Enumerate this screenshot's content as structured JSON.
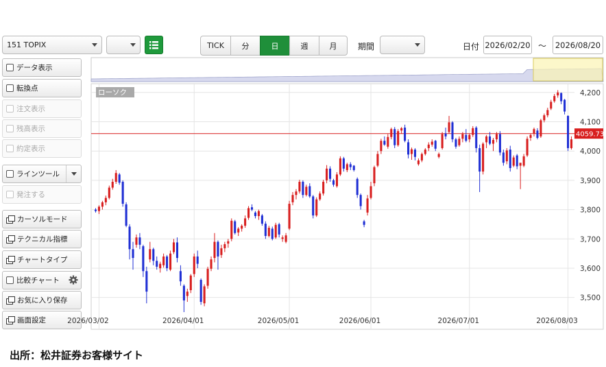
{
  "toolbar": {
    "symbol_select": "151 TOPIX",
    "secondary_select": "",
    "intervals": [
      "TICK",
      "分",
      "日",
      "週",
      "月"
    ],
    "active_interval": "日",
    "period_label": "期間",
    "period_select": "",
    "date_label": "日付",
    "date_from": "2026/02/20",
    "date_sep": "〜",
    "date_to": "2026/08/20"
  },
  "sidebar": {
    "items": [
      {
        "label": "データ表示",
        "kind": "checkbox",
        "enabled": true
      },
      {
        "label": "転換点",
        "kind": "checkbox",
        "enabled": true
      },
      {
        "label": "注文表示",
        "kind": "checkbox",
        "enabled": false
      },
      {
        "label": "残高表示",
        "kind": "checkbox",
        "enabled": false
      },
      {
        "label": "約定表示",
        "kind": "checkbox",
        "enabled": false
      },
      {
        "label": "ラインツール",
        "kind": "checkbox-dropdown",
        "enabled": true
      },
      {
        "label": "発注する",
        "kind": "checkbox",
        "enabled": false
      },
      {
        "label": "カーソルモード",
        "kind": "window",
        "enabled": true
      },
      {
        "label": "テクニカル指標",
        "kind": "window",
        "enabled": true
      },
      {
        "label": "チャートタイプ",
        "kind": "window",
        "enabled": true
      },
      {
        "label": "比較チャート",
        "kind": "checkbox-gear",
        "enabled": true
      },
      {
        "label": "お気に入り保存",
        "kind": "window",
        "enabled": true
      },
      {
        "label": "画面設定",
        "kind": "window",
        "enabled": true
      }
    ]
  },
  "chart_data": {
    "type": "candlestick",
    "series_label": "ローソク",
    "ylim": [
      3450,
      4230
    ],
    "yticks": [
      3500,
      3600,
      3700,
      3800,
      3900,
      4000,
      4100,
      4200
    ],
    "ytick_labels": [
      "3,500",
      "3,600",
      "3,700",
      "3,800",
      "3,900",
      "4,000",
      "4,100",
      "4,200"
    ],
    "xtick_labels": [
      "2026/03/02",
      "2026/04/01",
      "2026/05/01",
      "2026/06/01",
      "2026/07/01",
      "2026/08/03"
    ],
    "xtick_index": [
      1,
      29,
      57,
      81,
      110,
      139
    ],
    "current_price": 4059.73,
    "current_price_label": "4059.73",
    "up_color": "#d81e1e",
    "down_color": "#1f2fd4",
    "price_line_color": "#d81e1e",
    "grid": true,
    "candles": [
      [
        3800,
        3805,
        3790,
        3795
      ],
      [
        3795,
        3815,
        3785,
        3810
      ],
      [
        3810,
        3830,
        3800,
        3825
      ],
      [
        3825,
        3848,
        3815,
        3840
      ],
      [
        3840,
        3882,
        3835,
        3875
      ],
      [
        3875,
        3905,
        3868,
        3895
      ],
      [
        3895,
        3935,
        3888,
        3925
      ],
      [
        3920,
        3925,
        3885,
        3892
      ],
      [
        3895,
        3900,
        3810,
        3820
      ],
      [
        3818,
        3825,
        3740,
        3745
      ],
      [
        3742,
        3750,
        3630,
        3665
      ],
      [
        3665,
        3690,
        3595,
        3635
      ],
      [
        3680,
        3715,
        3670,
        3705
      ],
      [
        3705,
        3720,
        3665,
        3680
      ],
      [
        3675,
        3680,
        3570,
        3590
      ],
      [
        3590,
        3605,
        3480,
        3520
      ],
      [
        3630,
        3690,
        3620,
        3665
      ],
      [
        3665,
        3670,
        3610,
        3625
      ],
      [
        3625,
        3640,
        3595,
        3605
      ],
      [
        3600,
        3622,
        3585,
        3615
      ],
      [
        3610,
        3650,
        3602,
        3640
      ],
      [
        3640,
        3645,
        3590,
        3600
      ],
      [
        3595,
        3660,
        3590,
        3650
      ],
      [
        3655,
        3700,
        3648,
        3688
      ],
      [
        3688,
        3705,
        3620,
        3635
      ],
      [
        3590,
        3610,
        3540,
        3555
      ],
      [
        3540,
        3545,
        3450,
        3490
      ],
      [
        3505,
        3530,
        3485,
        3520
      ],
      [
        3525,
        3580,
        3515,
        3575
      ],
      [
        3580,
        3650,
        3570,
        3640
      ],
      [
        3640,
        3660,
        3600,
        3615
      ],
      [
        3560,
        3565,
        3475,
        3485
      ],
      [
        3480,
        3545,
        3470,
        3538
      ],
      [
        3540,
        3605,
        3530,
        3598
      ],
      [
        3598,
        3640,
        3590,
        3630
      ],
      [
        3635,
        3720,
        3620,
        3690
      ],
      [
        3690,
        3695,
        3595,
        3640
      ],
      [
        3645,
        3680,
        3635,
        3668
      ],
      [
        3668,
        3690,
        3655,
        3682
      ],
      [
        3684,
        3700,
        3670,
        3692
      ],
      [
        3700,
        3770,
        3692,
        3762
      ],
      [
        3760,
        3765,
        3715,
        3720
      ],
      [
        3722,
        3740,
        3710,
        3735
      ],
      [
        3735,
        3750,
        3725,
        3745
      ],
      [
        3745,
        3780,
        3738,
        3770
      ],
      [
        3772,
        3812,
        3765,
        3805
      ],
      [
        3808,
        3818,
        3795,
        3800
      ],
      [
        3790,
        3795,
        3770,
        3778
      ],
      [
        3778,
        3800,
        3765,
        3795
      ],
      [
        3780,
        3785,
        3745,
        3752
      ],
      [
        3752,
        3760,
        3700,
        3710
      ],
      [
        3710,
        3745,
        3705,
        3738
      ],
      [
        3735,
        3742,
        3695,
        3700
      ],
      [
        3705,
        3755,
        3700,
        3748
      ],
      [
        3750,
        3755,
        3705,
        3715
      ],
      [
        3700,
        3712,
        3690,
        3705
      ],
      [
        3690,
        3720,
        3685,
        3712
      ],
      [
        3735,
        3830,
        3730,
        3820
      ],
      [
        3825,
        3860,
        3815,
        3850
      ],
      [
        3850,
        3870,
        3835,
        3862
      ],
      [
        3862,
        3902,
        3855,
        3895
      ],
      [
        3895,
        3900,
        3840,
        3850
      ],
      [
        3850,
        3885,
        3845,
        3878
      ],
      [
        3880,
        3890,
        3840,
        3845
      ],
      [
        3845,
        3850,
        3770,
        3780
      ],
      [
        3780,
        3842,
        3775,
        3835
      ],
      [
        3835,
        3862,
        3830,
        3855
      ],
      [
        3855,
        3902,
        3848,
        3895
      ],
      [
        3900,
        3952,
        3890,
        3940
      ],
      [
        3940,
        3948,
        3895,
        3905
      ],
      [
        3900,
        3905,
        3878,
        3885
      ],
      [
        3880,
        3928,
        3875,
        3920
      ],
      [
        3920,
        3982,
        3915,
        3975
      ],
      [
        3975,
        3980,
        3930,
        3940
      ],
      [
        3935,
        3960,
        3928,
        3955
      ],
      [
        3955,
        3962,
        3935,
        3945
      ],
      [
        3950,
        3952,
        3930,
        3935
      ],
      [
        3905,
        3910,
        3840,
        3850
      ],
      [
        3850,
        3855,
        3800,
        3812
      ],
      [
        3760,
        3765,
        3740,
        3748
      ],
      [
        3790,
        3850,
        3780,
        3838
      ],
      [
        3840,
        3895,
        3835,
        3880
      ],
      [
        3890,
        3950,
        3880,
        3945
      ],
      [
        3950,
        4000,
        3945,
        3990
      ],
      [
        4000,
        4042,
        3990,
        4035
      ],
      [
        4035,
        4050,
        4018,
        4022
      ],
      [
        4015,
        4058,
        4008,
        4048
      ],
      [
        4048,
        4080,
        4040,
        4075
      ],
      [
        4075,
        4082,
        4010,
        4020
      ],
      [
        4020,
        4075,
        4015,
        4068
      ],
      [
        4070,
        4082,
        4060,
        4078
      ],
      [
        4080,
        4090,
        4030,
        4035
      ],
      [
        4030,
        4040,
        3975,
        3988
      ],
      [
        3990,
        4012,
        3970,
        4006
      ],
      [
        4005,
        4010,
        3968,
        3980
      ],
      [
        3955,
        3975,
        3950,
        3968
      ],
      [
        3968,
        3995,
        3962,
        3990
      ],
      [
        3990,
        4010,
        3985,
        4005
      ],
      [
        4010,
        4030,
        4000,
        4022
      ],
      [
        4022,
        4040,
        4015,
        4032
      ],
      [
        4035,
        4038,
        4000,
        4008
      ],
      [
        3980,
        3995,
        3975,
        3990
      ],
      [
        4010,
        4065,
        4005,
        4058
      ],
      [
        4060,
        4080,
        4040,
        4050
      ],
      [
        4065,
        4120,
        4060,
        4098
      ],
      [
        4098,
        4102,
        4030,
        4040
      ],
      [
        4040,
        4045,
        4008,
        4015
      ],
      [
        4020,
        4050,
        4015,
        4042
      ],
      [
        4042,
        4065,
        4030,
        4058
      ],
      [
        4055,
        4075,
        4030,
        4035
      ],
      [
        4040,
        4060,
        4030,
        4055
      ],
      [
        4055,
        4085,
        4048,
        4078
      ],
      [
        4080,
        4085,
        3995,
        4010
      ],
      [
        4010,
        4022,
        3860,
        3930
      ],
      [
        3930,
        4030,
        3920,
        4025
      ],
      [
        4030,
        4055,
        4010,
        4050
      ],
      [
        4050,
        4065,
        4020,
        4025
      ],
      [
        4025,
        4045,
        4000,
        4038
      ],
      [
        4040,
        4065,
        4030,
        4058
      ],
      [
        4058,
        4068,
        3985,
        3995
      ],
      [
        3995,
        4005,
        3950,
        3960
      ],
      [
        3965,
        4010,
        3955,
        4002
      ],
      [
        4005,
        4018,
        3930,
        3942
      ],
      [
        3950,
        3985,
        3945,
        3978
      ],
      [
        3985,
        3990,
        3938,
        3948
      ],
      [
        3950,
        3955,
        3870,
        3960
      ],
      [
        3950,
        3990,
        3945,
        3982
      ],
      [
        3985,
        4050,
        3980,
        4042
      ],
      [
        4045,
        4060,
        4035,
        4055
      ],
      [
        4060,
        4080,
        4050,
        4075
      ],
      [
        4070,
        4078,
        4040,
        4045
      ],
      [
        4050,
        4110,
        4045,
        4105
      ],
      [
        4105,
        4128,
        4098,
        4122
      ],
      [
        4122,
        4148,
        4115,
        4140
      ],
      [
        4145,
        4175,
        4140,
        4168
      ],
      [
        4170,
        4195,
        4165,
        4188
      ],
      [
        4190,
        4208,
        4182,
        4200
      ],
      [
        4198,
        4200,
        4160,
        4170
      ],
      [
        4175,
        4178,
        4125,
        4135
      ],
      [
        4120,
        4122,
        4000,
        4010
      ],
      [
        4010,
        4050,
        4005,
        4040
      ]
    ]
  }
}
